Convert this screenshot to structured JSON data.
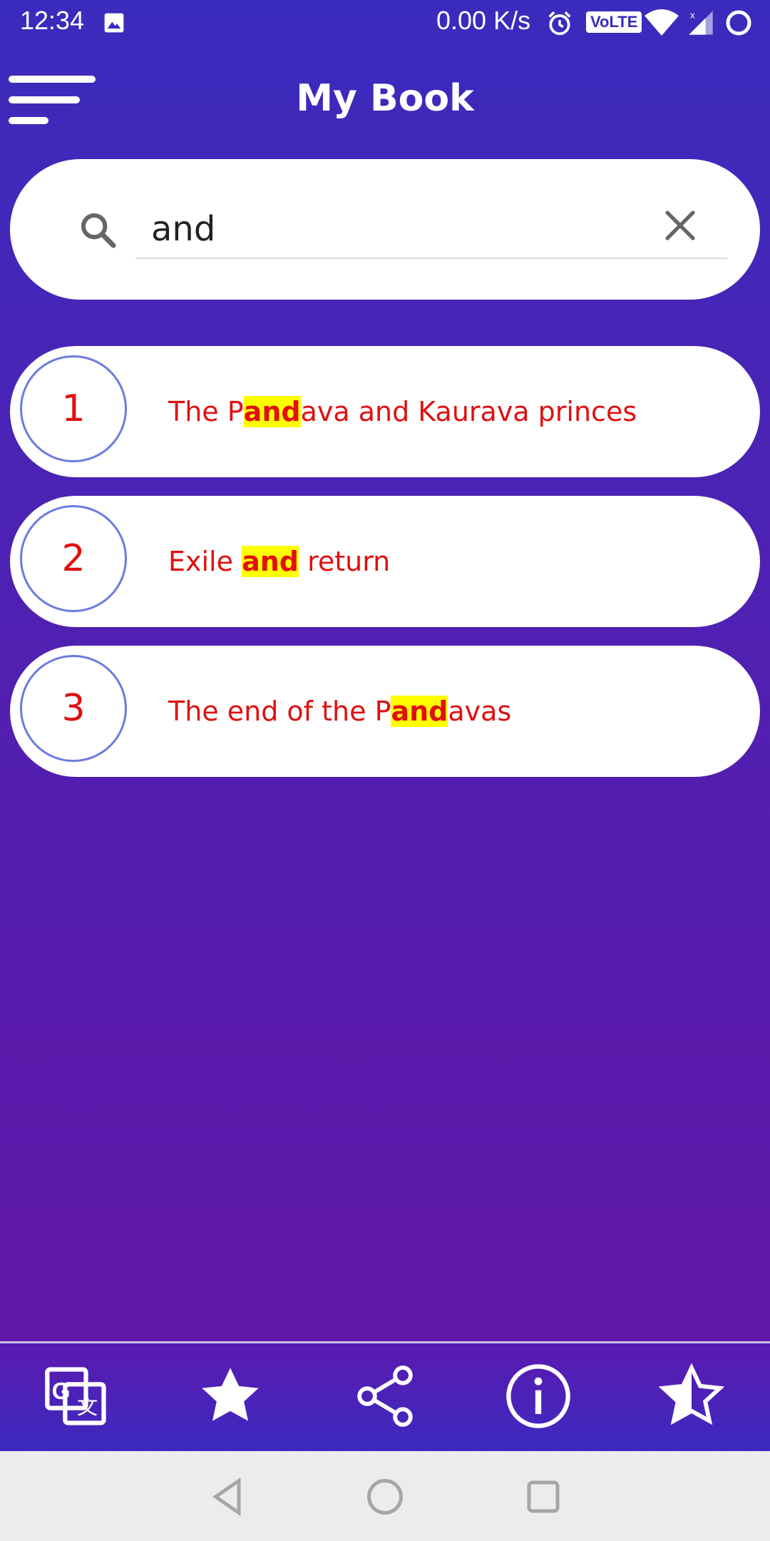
{
  "status_bar": {
    "time": "12:34",
    "speed": "0.00 K/s",
    "volte": "VoLTE",
    "icons": [
      "gallery-icon",
      "alarm-icon",
      "wifi-icon",
      "signal-icon",
      "battery-icon"
    ]
  },
  "header": {
    "title": "My Book",
    "menu_icon": "menu-icon"
  },
  "search": {
    "value": "and",
    "placeholder": "",
    "icon": "search-icon",
    "clear_icon": "close-icon"
  },
  "results": [
    {
      "number": "1",
      "before": "The P",
      "match": "and",
      "after": "ava and Kaurava princes"
    },
    {
      "number": "2",
      "before": "Exile ",
      "match": "and",
      "after": " return"
    },
    {
      "number": "3",
      "before": "The end of the P",
      "match": "and",
      "after": "avas"
    }
  ],
  "bottom_bar": {
    "buttons": [
      "translate-icon",
      "star-icon",
      "share-icon",
      "info-icon",
      "rate-icon"
    ]
  },
  "nav_bar": {
    "buttons": [
      "back-icon",
      "home-icon",
      "recents-icon"
    ]
  },
  "colors": {
    "background_top": "#3a2bbd",
    "background_bottom": "#6315a6",
    "result_text": "#e01010",
    "highlight": "#ffff00",
    "circle_border": "#6a7be0"
  }
}
